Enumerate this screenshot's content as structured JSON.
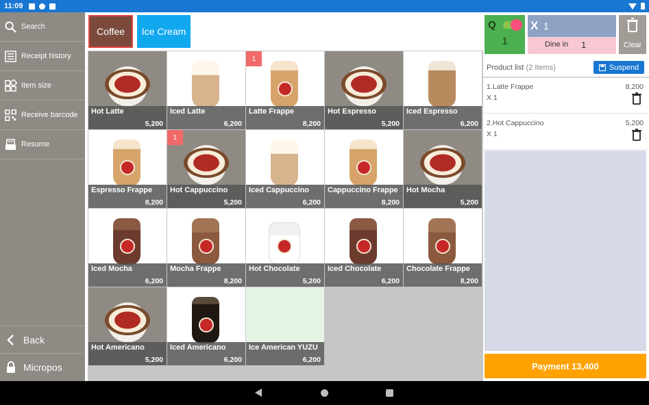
{
  "status_bar": {
    "time": "11:09"
  },
  "sidebar": {
    "items": [
      {
        "label": "Search",
        "icon": "search-icon"
      },
      {
        "label": "Receipt history",
        "icon": "receipt-icon"
      },
      {
        "label": "Item size",
        "icon": "grid-icon"
      },
      {
        "label": "Receive barcode",
        "icon": "qr-code-icon"
      },
      {
        "label": "Resume",
        "icon": "register-icon"
      }
    ],
    "back_label": "Back",
    "app_label": "Micropos"
  },
  "categories": [
    {
      "label": "Coffee",
      "selected": true,
      "color": "#7b4a3c"
    },
    {
      "label": "Ice Cream",
      "selected": false,
      "color": "#12a8f0"
    }
  ],
  "products": [
    {
      "name": "Hot Latte",
      "price": "5,200",
      "badge": ""
    },
    {
      "name": "Iced Latte",
      "price": "6,200",
      "badge": ""
    },
    {
      "name": "Latte Frappe",
      "price": "8,200",
      "badge": "1"
    },
    {
      "name": "Hot Espresso",
      "price": "5,200",
      "badge": ""
    },
    {
      "name": "Iced Espresso",
      "price": "6,200",
      "badge": ""
    },
    {
      "name": "Espresso Frappe",
      "price": "8,200",
      "badge": ""
    },
    {
      "name": "Hot Cappuccino",
      "price": "5,200",
      "badge": "1"
    },
    {
      "name": "Iced Cappuccino",
      "price": "6,200",
      "badge": ""
    },
    {
      "name": "Cappuccino Frappe",
      "price": "8,200",
      "badge": ""
    },
    {
      "name": "Hot Mocha",
      "price": "5,200",
      "badge": ""
    },
    {
      "name": "Iced Mocha",
      "price": "6,200",
      "badge": ""
    },
    {
      "name": "Mocha Frappe",
      "price": "8,200",
      "badge": ""
    },
    {
      "name": "Hot Chocolate",
      "price": "5,200",
      "badge": ""
    },
    {
      "name": "Iced Chocolate",
      "price": "6,200",
      "badge": ""
    },
    {
      "name": "Chocolate Frappe",
      "price": "8,200",
      "badge": ""
    },
    {
      "name": "Hot Americano",
      "price": "5,200",
      "badge": ""
    },
    {
      "name": "Iced Americano",
      "price": "6,200",
      "badge": ""
    },
    {
      "name": "Ice American YUZU",
      "price": "6,200",
      "badge": ""
    }
  ],
  "order_panel": {
    "q_label": "Q",
    "q_value": "1",
    "x_label": "X",
    "x_value": "1",
    "dine_label": "Dine in",
    "dine_value": "1",
    "clear_label": "Clear",
    "product_list_label": "Product list",
    "product_count": "(2 Items)",
    "suspend_label": "Suspend",
    "items": [
      {
        "name": "1.Latte Frappe",
        "qty": "X 1",
        "price": "8,200"
      },
      {
        "name": "2.Hot Cappuccino",
        "qty": "X 1",
        "price": "5,200"
      }
    ],
    "payment_label": "Payment 13,400"
  },
  "colors": {
    "status_bar": "#1976d2",
    "sidebar": "#8e8a84",
    "payment": "#ffa200",
    "suspend": "#1976d2",
    "q_box": "#4caf50",
    "x_box": "#8fa2c4",
    "dine_box": "#f7c8d3",
    "badge": "#f06a6a"
  }
}
